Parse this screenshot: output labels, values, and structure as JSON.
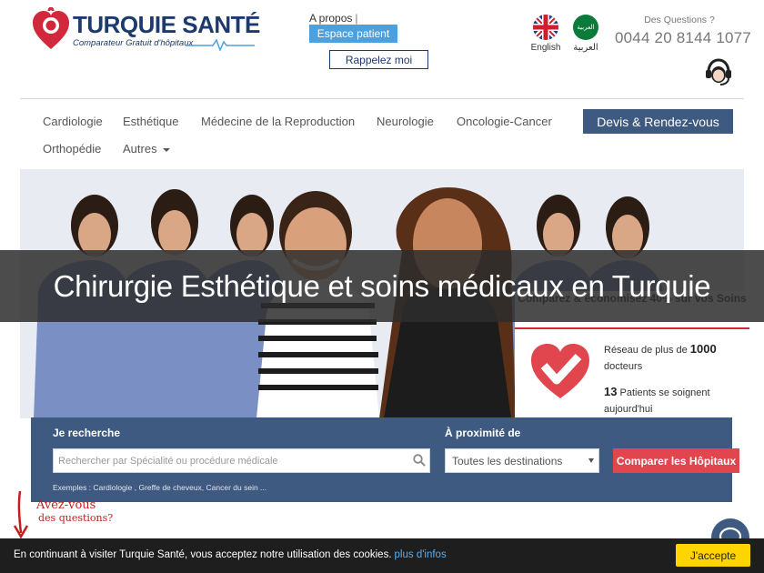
{
  "header": {
    "logo": {
      "title_part1": "TURQUIE",
      "title_part2": "SANTÉ",
      "subtitle": "Comparateur Gratuit d'hôpitaux"
    },
    "apropos_label": "A propos",
    "separator": "|",
    "patient_space_label": "Espace patient",
    "recall_label": "Rappelez moi",
    "languages": [
      {
        "label": "English",
        "icon": "uk-flag-icon"
      },
      {
        "label": "العربية",
        "icon": "saudi-flag-icon",
        "flag_text": "العربية"
      }
    ],
    "questions_label": "Des Questions ?",
    "phone": "0044 20 8144 1077"
  },
  "nav": {
    "items": [
      "Cardiologie",
      "Esthétique",
      "Médecine de la Reproduction",
      "Neurologie",
      "Oncologie-Cancer",
      "Orthopédie",
      "Autres"
    ],
    "devis_label": "Devis & Rendez-vous"
  },
  "hero": {
    "title": "Chirurgie Esthétique et soins médicaux en Turquie",
    "promo": {
      "heading": "Comparez & économisez 40% sur vos Soins",
      "stat1_prefix": "Réseau de plus de",
      "stat1_value": "1000",
      "stat1_suffix": "docteurs",
      "stat2_value": "13",
      "stat2_text": "Patients se soignent aujourd'hui"
    }
  },
  "search": {
    "label_search": "Je recherche",
    "placeholder": "Rechercher par Spécialité ou procédure médicale",
    "label_near": "À proximité de",
    "destination": "Toutes les destinations",
    "compare_label": "Comparer les Hôpitaux",
    "examples": "Exemples : Cardiologie , Greffe de cheveux, Cancer du sein ..."
  },
  "note": {
    "line1": "Avez-vous",
    "line2": "des questions?"
  },
  "cookie": {
    "text": "En continuant à visiter Turquie Santé, vous acceptez notre utilisation des cookies.",
    "link": "plus d'infos",
    "accept": "J'accepte"
  },
  "colors": {
    "brand": "#1d3a6e",
    "accent_blue": "#4ca0dd",
    "panel": "#3f5a80",
    "red": "#e1464f",
    "cookie_btn": "#ffd500"
  }
}
